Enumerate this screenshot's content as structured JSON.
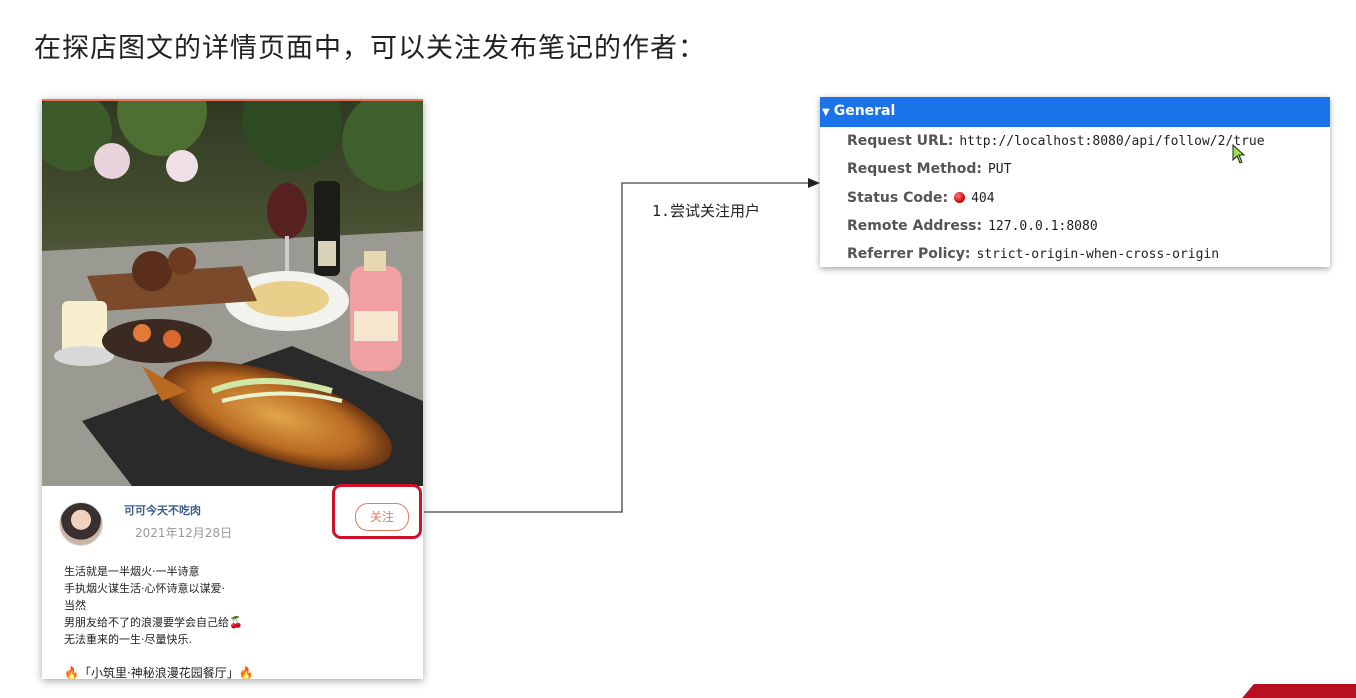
{
  "slide": {
    "title": "在探店图文的详情页面中，可以关注发布笔记的作者："
  },
  "post": {
    "author_name": "可可今天不吃肉",
    "date": "2021年12月28日",
    "follow_label": "关注",
    "lines": [
      "生活就是一半烟火·一半诗意",
      "手执烟火谋生活·心怀诗意以谋爱·",
      "当然",
      "男朋友给不了的浪漫要学会自己给🍒",
      "无法重来的一生·尽量快乐."
    ],
    "tag_line": "🔥「小筑里·神秘浪漫花园餐厅」🔥",
    "photo_icon": "food-photo"
  },
  "connector": {
    "label": "1.尝试关注用户"
  },
  "devtools": {
    "section_title": "General",
    "rows": [
      {
        "key": "Request URL:",
        "value": "http://localhost:8080/api/follow/2/true"
      },
      {
        "key": "Request Method:",
        "value": "PUT"
      },
      {
        "key": "Status Code:",
        "value": "404",
        "status_color": "#d10d0d"
      },
      {
        "key": "Remote Address:",
        "value": "127.0.0.1:8080"
      },
      {
        "key": "Referrer Policy:",
        "value": "strict-origin-when-cross-origin"
      }
    ]
  },
  "colors": {
    "accent_blue": "#1a73e8",
    "highlight_red": "#d0112b",
    "follow_orange": "#e07b5f"
  }
}
